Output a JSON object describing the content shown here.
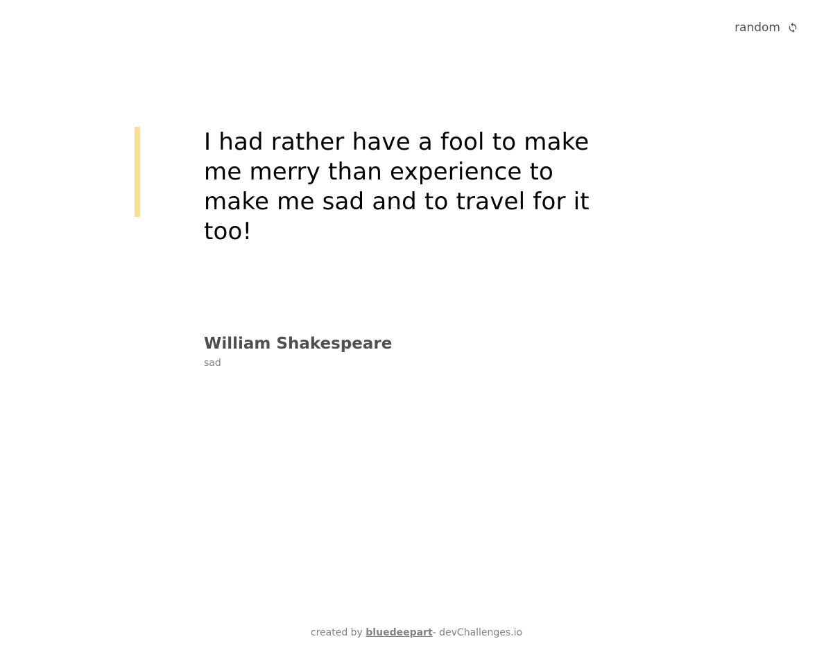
{
  "header": {
    "random_label": "random",
    "random_icon": "refresh-icon"
  },
  "quote": {
    "text": "I had rather have a fool to make me merry than experience to make me sad and to travel for it too!",
    "accent_color": "#F7DF94"
  },
  "author": {
    "name": "William Shakespeare",
    "genre": "sad"
  },
  "footer": {
    "prefix": "created by ",
    "link_text": "bluedeepart",
    "suffix": "- devChallenges.io"
  }
}
